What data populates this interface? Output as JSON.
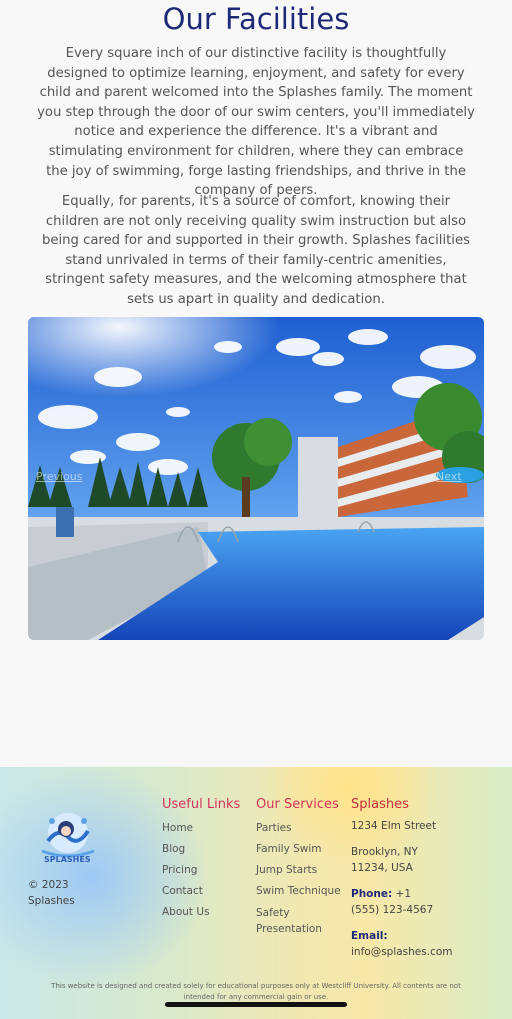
{
  "facilities": {
    "title": "Our Facilities",
    "paragraph1": "Every square inch of our distinctive facility is thoughtfully designed to optimize learning, enjoyment, and safety for every child and parent welcomed into the Splashes family. The moment you step through the door of our swim centers, you'll immediately notice and experience the difference. It's a vibrant and stimulating environment for children, where they can embrace the joy of swimming, forge lasting friendships, and thrive in the company of peers.",
    "paragraph2": "Equally, for parents, it's a source of comfort, knowing their children are not only receiving quality swim instruction but also being cared for and supported in their growth. Splashes facilities stand unrivaled in terms of their family-centric amenities, stringent safety measures, and the welcoming atmosphere that sets us apart in quality and dedication."
  },
  "carousel": {
    "prev_label": "Previous",
    "next_label": "Next"
  },
  "footer": {
    "logo_text": "SPLASHES",
    "copyright": "© 2023 Splashes",
    "useful_links": {
      "heading": "Useful Links",
      "items": [
        "Home",
        "Blog",
        "Pricing",
        "Contact",
        "About Us"
      ]
    },
    "services": {
      "heading": "Our Services",
      "items": [
        "Parties",
        "Family Swim",
        "Jump Starts",
        "Swim Technique",
        "Safety Presentation"
      ]
    },
    "contact": {
      "heading": "Splashes",
      "address_line1": "1234 Elm Street",
      "address_line2": "Brooklyn, NY 11234, USA",
      "phone_label": "Phone:",
      "phone": "+1 (555) 123-4567",
      "email_label": "Email:",
      "email": "info@splashes.com"
    },
    "disclaimer": "This website is designed and created solely for educational purposes only at Westcliff University. All contents are not intended for any commercial gain or use."
  },
  "colors": {
    "title": "#1e2a78",
    "footer_heading": "#d6335b",
    "body_text": "#555555"
  }
}
